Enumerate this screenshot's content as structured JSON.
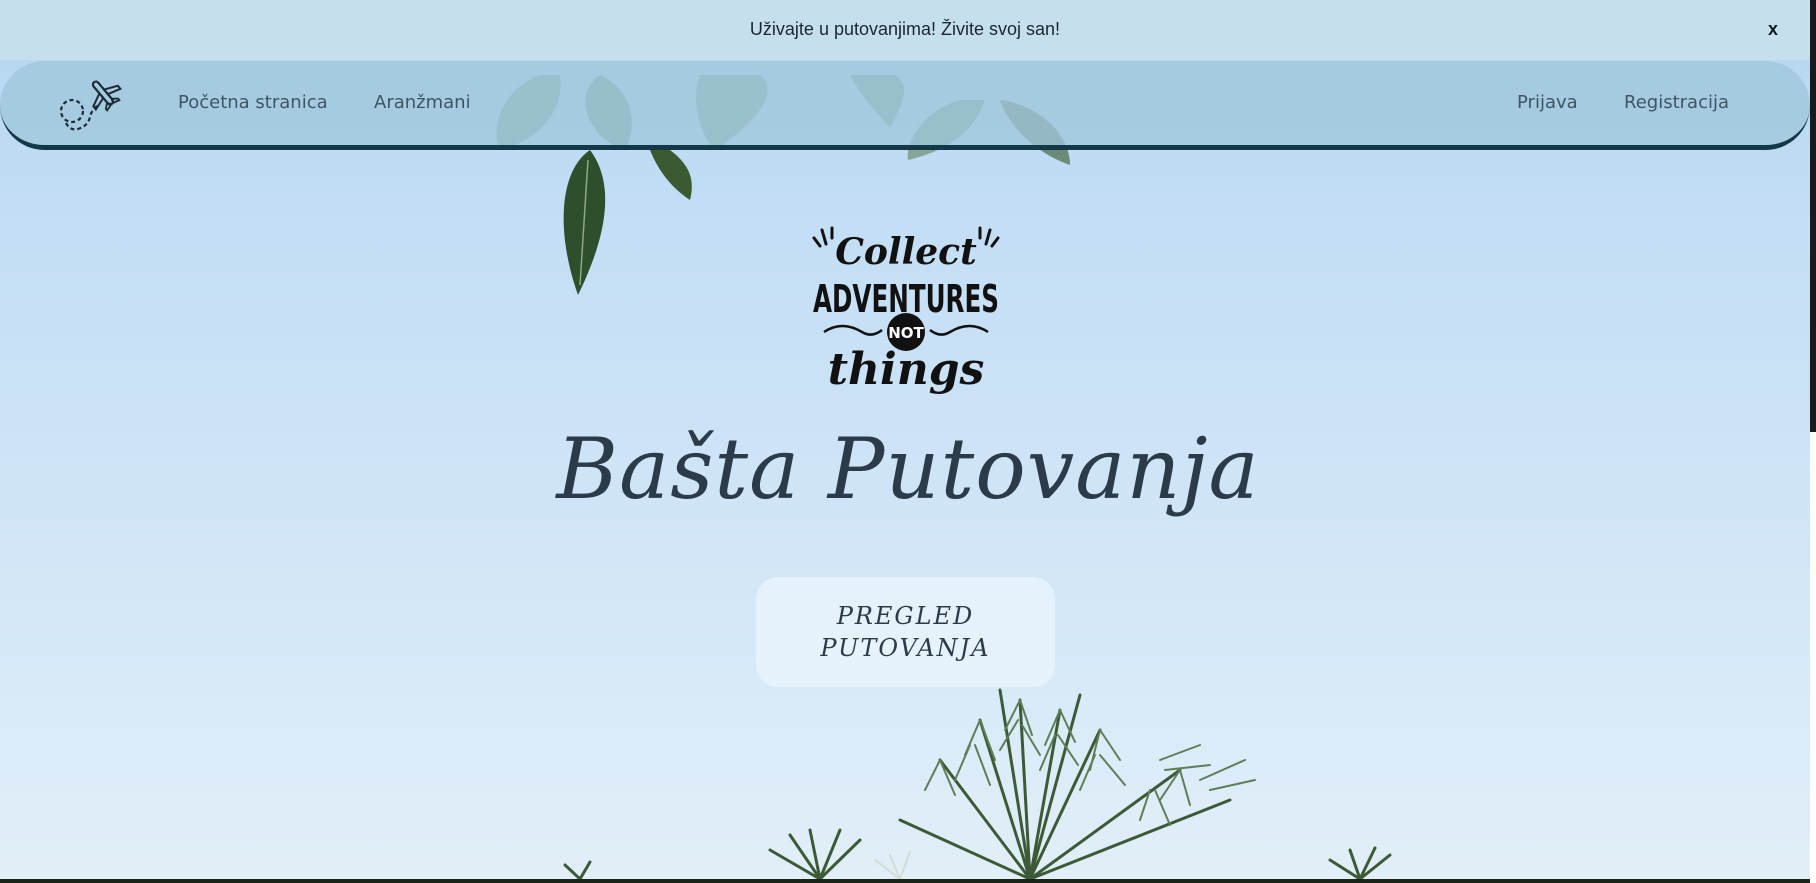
{
  "announcement": {
    "text": "Uživajte u putovanjima! Živite svoj san!",
    "close_label": "x"
  },
  "navbar": {
    "logo_icon": "plane-dashed-path-icon",
    "left_links": [
      "Početna stranica",
      "Aranžmani"
    ],
    "right_links": [
      "Prijava",
      "Registracija"
    ]
  },
  "hero": {
    "badge": {
      "line1": "Collect",
      "line2": "ADVENTURES",
      "line3": "NOT",
      "line4": "things"
    },
    "title": "Bašta Putovanja",
    "cta_label": "PREGLED PUTOVANJA"
  },
  "colors": {
    "announcement_bg": "#c6dfed",
    "navbar_bg": "#a0c6db",
    "navbar_border": "#143848",
    "sky_top": "#b4d6f0",
    "sky_bottom": "#e2eef8",
    "text_dark": "#2b3b4a"
  }
}
